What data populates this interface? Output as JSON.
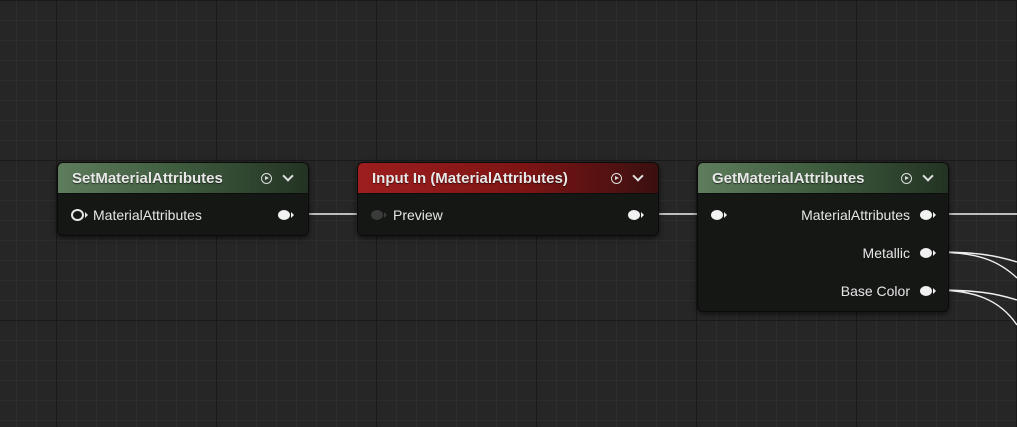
{
  "nodes": {
    "set_material_attributes": {
      "title": "SetMaterialAttributes",
      "input_pin": "MaterialAttributes"
    },
    "input_in": {
      "title": "Input In (MaterialAttributes)",
      "input_pin": "Preview"
    },
    "get_material_attributes": {
      "title": "GetMaterialAttributes",
      "outputs": [
        "MaterialAttributes",
        "Metallic",
        "Base Color"
      ]
    }
  },
  "colors": {
    "canvas": "#262626",
    "wire": "#f0f0f0",
    "header_green": "#5e7d5c",
    "header_red": "#9d1e1e",
    "node_body": "#151715"
  },
  "icons": {
    "preview": "play-circle-icon",
    "collapse": "chevron-down-icon"
  }
}
